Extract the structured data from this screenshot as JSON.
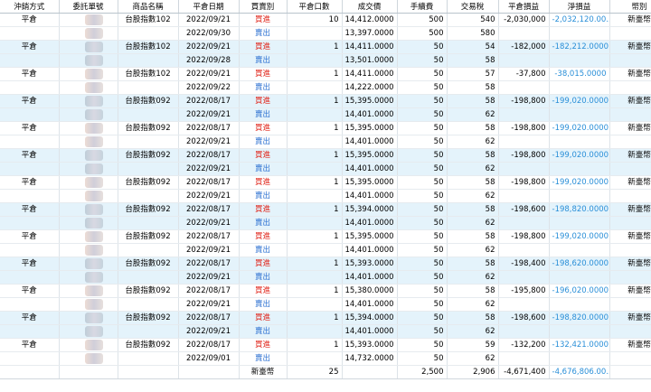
{
  "headers": [
    "沖銷方式",
    "委託單號",
    "商品名稱",
    "平倉日期",
    "買賣別",
    "平倉口數",
    "成交價",
    "手續費",
    "交易稅",
    "平倉損益",
    "淨損益",
    "幣別"
  ],
  "colors": {
    "buy": "#e0261b",
    "sell": "#2a6fd1",
    "net": "#2a8fd8",
    "highlight_row": "#e4f3fb"
  },
  "rows": [
    {
      "method": "平倉",
      "order": "",
      "product": "台股指數102",
      "date": "2022/09/21",
      "side": "買進",
      "qty": "10",
      "price": "14,412.0000",
      "fee": "500",
      "tax": "540",
      "pnl": "-2,030,000",
      "net": "-2,032,120.00...",
      "cur": "新臺幣",
      "hl": false
    },
    {
      "method": "",
      "order": "",
      "product": "",
      "date": "2022/09/30",
      "side": "賣出",
      "qty": "",
      "price": "13,397.0000",
      "fee": "500",
      "tax": "580",
      "pnl": "",
      "net": "",
      "cur": "",
      "hl": false
    },
    {
      "method": "平倉",
      "order": "",
      "product": "台股指數102",
      "date": "2022/09/21",
      "side": "買進",
      "qty": "1",
      "price": "14,411.0000",
      "fee": "50",
      "tax": "54",
      "pnl": "-182,000",
      "net": "-182,212.0000",
      "cur": "新臺幣",
      "hl": true
    },
    {
      "method": "",
      "order": "",
      "product": "",
      "date": "2022/09/28",
      "side": "賣出",
      "qty": "",
      "price": "13,501.0000",
      "fee": "50",
      "tax": "58",
      "pnl": "",
      "net": "",
      "cur": "",
      "hl": true
    },
    {
      "method": "平倉",
      "order": "",
      "product": "台股指數102",
      "date": "2022/09/21",
      "side": "買進",
      "qty": "1",
      "price": "14,411.0000",
      "fee": "50",
      "tax": "57",
      "pnl": "-37,800",
      "net": "-38,015.0000",
      "cur": "新臺幣",
      "hl": false
    },
    {
      "method": "",
      "order": "",
      "product": "",
      "date": "2022/09/22",
      "side": "賣出",
      "qty": "",
      "price": "14,222.0000",
      "fee": "50",
      "tax": "58",
      "pnl": "",
      "net": "",
      "cur": "",
      "hl": false
    },
    {
      "method": "平倉",
      "order": "",
      "product": "台股指數092",
      "date": "2022/08/17",
      "side": "買進",
      "qty": "1",
      "price": "15,395.0000",
      "fee": "50",
      "tax": "58",
      "pnl": "-198,800",
      "net": "-199,020.0000",
      "cur": "新臺幣",
      "hl": true
    },
    {
      "method": "",
      "order": "",
      "product": "",
      "date": "2022/09/21",
      "side": "賣出",
      "qty": "",
      "price": "14,401.0000",
      "fee": "50",
      "tax": "62",
      "pnl": "",
      "net": "",
      "cur": "",
      "hl": true
    },
    {
      "method": "平倉",
      "order": "",
      "product": "台股指數092",
      "date": "2022/08/17",
      "side": "買進",
      "qty": "1",
      "price": "15,395.0000",
      "fee": "50",
      "tax": "58",
      "pnl": "-198,800",
      "net": "-199,020.0000",
      "cur": "新臺幣",
      "hl": false
    },
    {
      "method": "",
      "order": "",
      "product": "",
      "date": "2022/09/21",
      "side": "賣出",
      "qty": "",
      "price": "14,401.0000",
      "fee": "50",
      "tax": "62",
      "pnl": "",
      "net": "",
      "cur": "",
      "hl": false
    },
    {
      "method": "平倉",
      "order": "",
      "product": "台股指數092",
      "date": "2022/08/17",
      "side": "買進",
      "qty": "1",
      "price": "15,395.0000",
      "fee": "50",
      "tax": "58",
      "pnl": "-198,800",
      "net": "-199,020.0000",
      "cur": "新臺幣",
      "hl": true
    },
    {
      "method": "",
      "order": "",
      "product": "",
      "date": "2022/09/21",
      "side": "賣出",
      "qty": "",
      "price": "14,401.0000",
      "fee": "50",
      "tax": "62",
      "pnl": "",
      "net": "",
      "cur": "",
      "hl": true
    },
    {
      "method": "平倉",
      "order": "",
      "product": "台股指數092",
      "date": "2022/08/17",
      "side": "買進",
      "qty": "1",
      "price": "15,395.0000",
      "fee": "50",
      "tax": "58",
      "pnl": "-198,800",
      "net": "-199,020.0000",
      "cur": "新臺幣",
      "hl": false
    },
    {
      "method": "",
      "order": "",
      "product": "",
      "date": "2022/09/21",
      "side": "賣出",
      "qty": "",
      "price": "14,401.0000",
      "fee": "50",
      "tax": "62",
      "pnl": "",
      "net": "",
      "cur": "",
      "hl": false
    },
    {
      "method": "平倉",
      "order": "",
      "product": "台股指數092",
      "date": "2022/08/17",
      "side": "買進",
      "qty": "1",
      "price": "15,394.0000",
      "fee": "50",
      "tax": "58",
      "pnl": "-198,600",
      "net": "-198,820.0000",
      "cur": "新臺幣",
      "hl": true
    },
    {
      "method": "",
      "order": "",
      "product": "",
      "date": "2022/09/21",
      "side": "賣出",
      "qty": "",
      "price": "14,401.0000",
      "fee": "50",
      "tax": "62",
      "pnl": "",
      "net": "",
      "cur": "",
      "hl": true
    },
    {
      "method": "平倉",
      "order": "",
      "product": "台股指數092",
      "date": "2022/08/17",
      "side": "買進",
      "qty": "1",
      "price": "15,395.0000",
      "fee": "50",
      "tax": "58",
      "pnl": "-198,800",
      "net": "-199,020.0000",
      "cur": "新臺幣",
      "hl": false
    },
    {
      "method": "",
      "order": "",
      "product": "",
      "date": "2022/09/21",
      "side": "賣出",
      "qty": "",
      "price": "14,401.0000",
      "fee": "50",
      "tax": "62",
      "pnl": "",
      "net": "",
      "cur": "",
      "hl": false
    },
    {
      "method": "平倉",
      "order": "",
      "product": "台股指數092",
      "date": "2022/08/17",
      "side": "買進",
      "qty": "1",
      "price": "15,393.0000",
      "fee": "50",
      "tax": "58",
      "pnl": "-198,400",
      "net": "-198,620.0000",
      "cur": "新臺幣",
      "hl": true
    },
    {
      "method": "",
      "order": "",
      "product": "",
      "date": "2022/09/21",
      "side": "賣出",
      "qty": "",
      "price": "14,401.0000",
      "fee": "50",
      "tax": "62",
      "pnl": "",
      "net": "",
      "cur": "",
      "hl": true
    },
    {
      "method": "平倉",
      "order": "",
      "product": "台股指數092",
      "date": "2022/08/17",
      "side": "買進",
      "qty": "1",
      "price": "15,380.0000",
      "fee": "50",
      "tax": "58",
      "pnl": "-195,800",
      "net": "-196,020.0000",
      "cur": "新臺幣",
      "hl": false
    },
    {
      "method": "",
      "order": "",
      "product": "",
      "date": "2022/09/21",
      "side": "賣出",
      "qty": "",
      "price": "14,401.0000",
      "fee": "50",
      "tax": "62",
      "pnl": "",
      "net": "",
      "cur": "",
      "hl": false
    },
    {
      "method": "平倉",
      "order": "",
      "product": "台股指數092",
      "date": "2022/08/17",
      "side": "買進",
      "qty": "1",
      "price": "15,394.0000",
      "fee": "50",
      "tax": "58",
      "pnl": "-198,600",
      "net": "-198,820.0000",
      "cur": "新臺幣",
      "hl": true
    },
    {
      "method": "",
      "order": "",
      "product": "",
      "date": "2022/09/21",
      "side": "賣出",
      "qty": "",
      "price": "14,401.0000",
      "fee": "50",
      "tax": "62",
      "pnl": "",
      "net": "",
      "cur": "",
      "hl": true
    },
    {
      "method": "平倉",
      "order": "",
      "product": "台股指數092",
      "date": "2022/08/17",
      "side": "買進",
      "qty": "1",
      "price": "15,393.0000",
      "fee": "50",
      "tax": "59",
      "pnl": "-132,200",
      "net": "-132,421.0000",
      "cur": "新臺幣",
      "hl": false
    },
    {
      "method": "",
      "order": "",
      "product": "",
      "date": "2022/09/01",
      "side": "賣出",
      "qty": "",
      "price": "14,732.0000",
      "fee": "50",
      "tax": "62",
      "pnl": "",
      "net": "",
      "cur": "",
      "hl": false
    }
  ],
  "summary": {
    "side": "新臺幣",
    "qty": "25",
    "fee": "2,500",
    "tax": "2,906",
    "pnl": "-4,671,400",
    "net": "-4,676,806.00..."
  }
}
